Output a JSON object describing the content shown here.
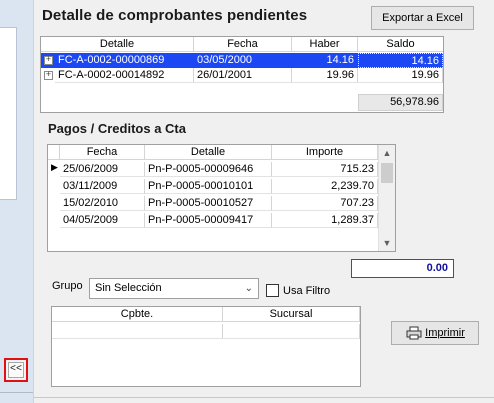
{
  "left_panel": {
    "collapse_label": "<<"
  },
  "pending": {
    "title": "Detalle de comprobantes pendientes",
    "export_label": "Exportar a Excel",
    "columns": [
      "Detalle",
      "Fecha",
      "Haber",
      "Saldo"
    ],
    "rows": [
      {
        "detalle": "FC-A-0002-00000869",
        "fecha": "03/05/2000",
        "haber": "14.16",
        "saldo": "14.16",
        "selected": true
      },
      {
        "detalle": "FC-A-0002-00014892",
        "fecha": "26/01/2001",
        "haber": "19.96",
        "saldo": "19.96",
        "selected": false
      }
    ],
    "total": "56,978.96"
  },
  "payments": {
    "title": "Pagos / Creditos a Cta",
    "columns": [
      "Fecha",
      "Detalle",
      "Importe"
    ],
    "rows": [
      {
        "fecha": "25/06/2009",
        "detalle": "Pn-P-0005-00009646",
        "importe": "715.23",
        "current": true
      },
      {
        "fecha": "03/11/2009",
        "detalle": "Pn-P-0005-00010101",
        "importe": "2,239.70",
        "current": false
      },
      {
        "fecha": "15/02/2010",
        "detalle": "Pn-P-0005-00010527",
        "importe": "707.23",
        "current": false
      },
      {
        "fecha": "04/05/2009",
        "detalle": "Pn-P-0005-00009417",
        "importe": "1,289.37",
        "current": false
      }
    ],
    "amount": "0.00"
  },
  "filters": {
    "grupo_label": "Grupo",
    "grupo_value": "Sin Selección",
    "usa_filtro_label": "Usa Filtro",
    "usa_filtro_checked": false
  },
  "comprobantes": {
    "columns": [
      "Cpbte.",
      "Sucursal"
    ]
  },
  "print": {
    "label": "Imprimir"
  },
  "colors": {
    "selection": "#1c48f4",
    "highlight_border": "#e01010",
    "amount_text": "#10109a"
  }
}
